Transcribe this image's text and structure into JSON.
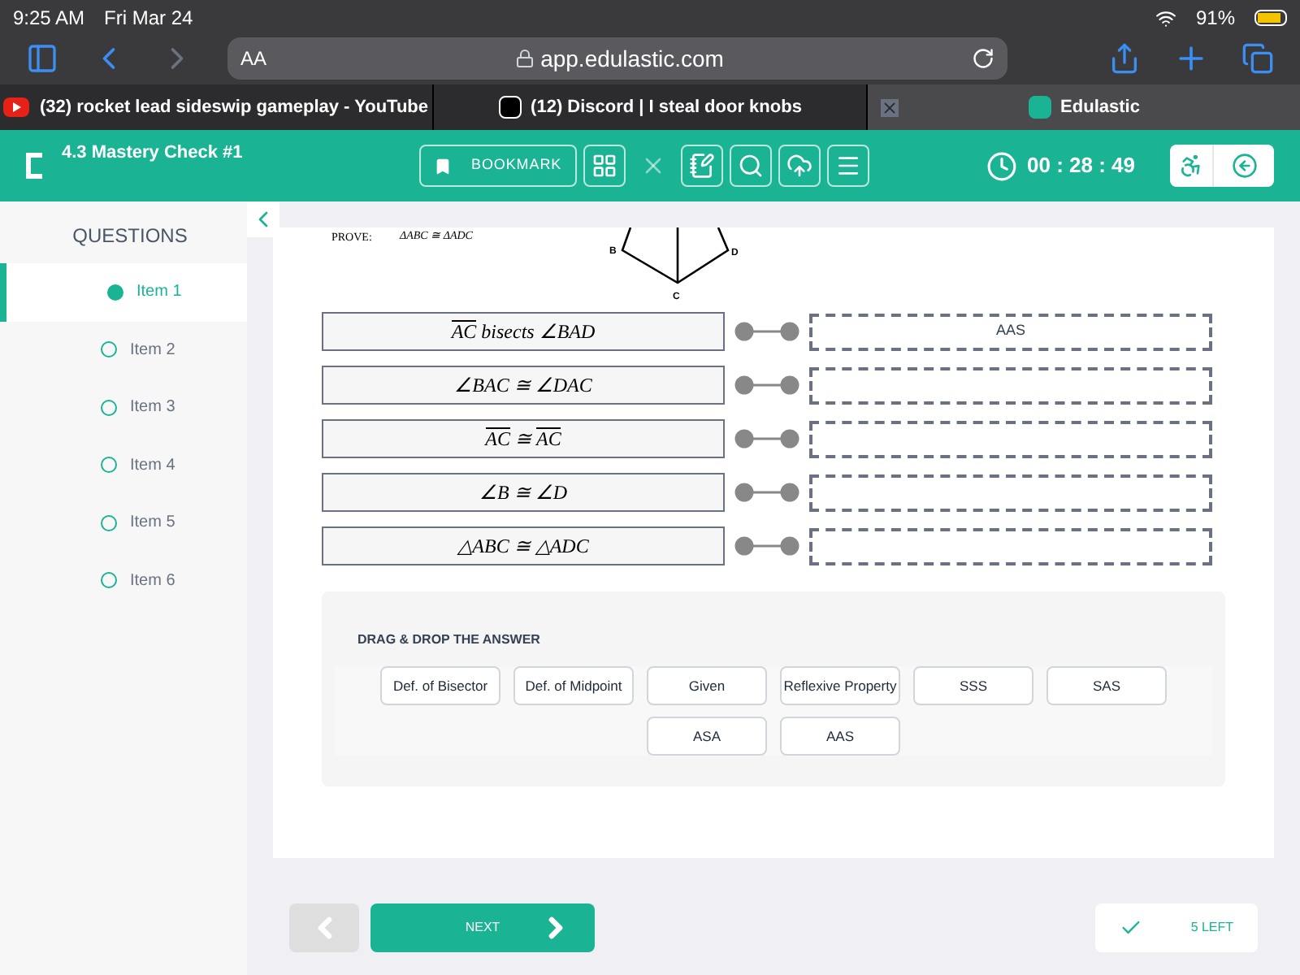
{
  "status_bar": {
    "time": "9:25 AM",
    "date": "Fri Mar 24",
    "battery": "91%"
  },
  "browser": {
    "text_size": "AA",
    "url": "app.edulastic.com"
  },
  "browser_tabs": [
    {
      "label": "(32) rocket lead sideswip gameplay - YouTube",
      "kind": "video",
      "selected": false
    },
    {
      "label": "(12) Discord | I steal door knobs",
      "kind": "discord",
      "selected": false
    },
    {
      "label": "Edulastic",
      "kind": "edu",
      "selected": true
    }
  ],
  "header": {
    "title": "4.3 Mastery Check #1",
    "bookmark": "BOOKMARK",
    "tools": [
      {
        "kind": "grid",
        "disabled": false
      },
      {
        "kind": "cross",
        "disabled": true
      },
      {
        "kind": "notepad",
        "disabled": false
      },
      {
        "kind": "magnifier",
        "disabled": false
      },
      {
        "kind": "upload",
        "disabled": false
      },
      {
        "kind": "lines",
        "disabled": false
      }
    ],
    "timer": "00 : 28 : 49"
  },
  "sidebar": {
    "title": "QUESTIONS",
    "items": [
      {
        "label": "Item 1",
        "selected": true
      },
      {
        "label": "Item 2",
        "selected": false
      },
      {
        "label": "Item 3",
        "selected": false
      },
      {
        "label": "Item 4",
        "selected": false
      },
      {
        "label": "Item 5",
        "selected": false
      },
      {
        "label": "Item 6",
        "selected": false
      }
    ]
  },
  "question": {
    "prove_label": "PROVE:",
    "prove_statement": "ΔABC ≅ ΔADC",
    "diagram_labels": [
      "B",
      "D",
      "C"
    ],
    "rows": [
      {
        "statement": [
          {
            "text": "AC",
            "overline": true
          },
          {
            "text": " bisects ∠BAD",
            "overline": false
          }
        ],
        "answer": "AAS"
      },
      {
        "statement": [
          {
            "text": "∠BAC ≅ ∠DAC",
            "overline": false
          }
        ]
      },
      {
        "statement": [
          {
            "text": "AC",
            "overline": true
          },
          {
            "text": " ≅ ",
            "overline": false
          },
          {
            "text": "AC",
            "overline": true
          }
        ]
      },
      {
        "statement": [
          {
            "text": "∠B ≅ ∠D",
            "overline": false
          }
        ]
      },
      {
        "statement": [
          {
            "text": "△ABC ≅ △ADC",
            "overline": false
          }
        ]
      }
    ]
  },
  "answers": {
    "title": "DRAG & DROP THE ANSWER",
    "options": [
      "Def. of Bisector",
      "Def. of Midpoint",
      "Given",
      "Reflexive Property",
      "SSS",
      "SAS",
      "ASA",
      "AAS"
    ]
  },
  "footer": {
    "next": "NEXT",
    "left": "5 LEFT"
  }
}
